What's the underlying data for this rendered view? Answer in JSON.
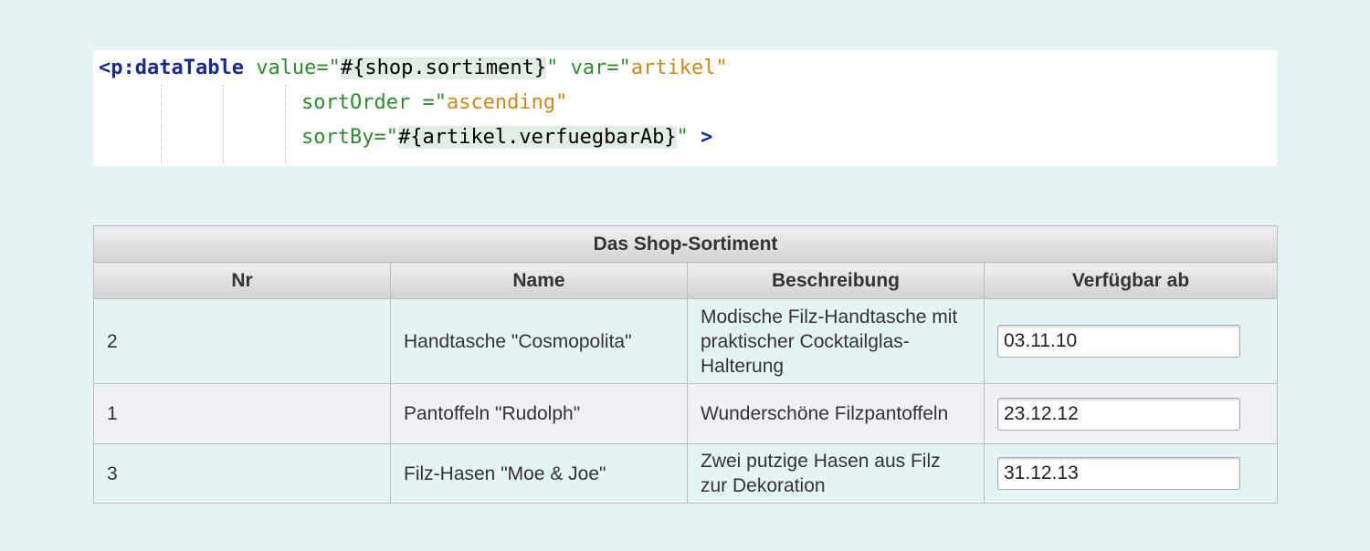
{
  "code": {
    "line1": {
      "tag": "<p:dataTable",
      "attr1": " value=\"",
      "expr1": "#{shop.sortiment}",
      "close1": "\"",
      "attr2": " var=\"",
      "str2": "artikel",
      "close2": "\""
    },
    "line2": {
      "attr": "sortOrder =\"",
      "str": "ascending",
      "close": "\""
    },
    "line3": {
      "attr": "sortBy=\"",
      "expr": "#{artikel.verfuegbarAb}",
      "close": "\"",
      "end": " >"
    }
  },
  "table": {
    "title": "Das Shop-Sortiment",
    "headers": [
      "Nr",
      "Name",
      "Beschreibung",
      "Verfügbar ab"
    ],
    "rows": [
      {
        "nr": "2",
        "name": "Handtasche \"Cosmopolita\"",
        "desc": "Modische Filz-Handtasche mit praktischer Cocktailglas-Halterung",
        "date": "03.11.10"
      },
      {
        "nr": "1",
        "name": "Pantoffeln \"Rudolph\"",
        "desc": "Wunderschöne Filzpantoffeln",
        "date": "23.12.12"
      },
      {
        "nr": "3",
        "name": "Filz-Hasen \"Moe & Joe\"",
        "desc": "Zwei putzige Hasen aus Filz zur Dekoration",
        "date": "31.12.13"
      }
    ]
  }
}
